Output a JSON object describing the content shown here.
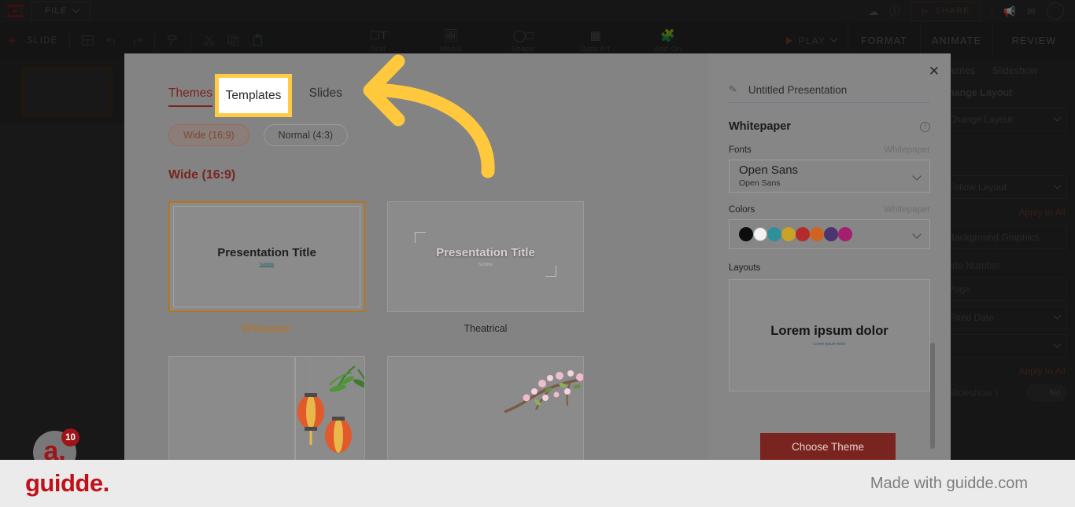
{
  "app": {
    "logo_icon": "presentation-play-icon",
    "file_menu": "FILE",
    "topbar_icons": [
      "cloud-check-icon",
      "info-icon"
    ],
    "share_label": "SHARE",
    "share_icon": "share-nodes-icon",
    "megaphone_icon": "megaphone-icon",
    "mail_icon": "mail-edit-icon",
    "avatar": "user-avatar"
  },
  "toolbar": {
    "add_slide": "SLIDE",
    "layout_icon": "layout-grid-icon",
    "undo_icon": "undo-icon",
    "redo_icon": "redo-icon",
    "paint_icon": "paint-roller-icon",
    "cut_icon": "scissors-icon",
    "copy_icon": "copy-icon",
    "paste_icon": "paste-icon",
    "insert_tools": [
      {
        "label": "Text",
        "icon": "text-box-icon"
      },
      {
        "label": "Media",
        "icon": "image-icon"
      },
      {
        "label": "Shape",
        "icon": "shapes-icon"
      },
      {
        "label": "Data Art",
        "icon": "chart-grid-icon"
      },
      {
        "label": "Add-On",
        "icon": "puzzle-piece-icon"
      }
    ],
    "play_label": "PLAY",
    "ribbon_tabs": [
      "FORMAT",
      "ANIMATE",
      "REVIEW"
    ]
  },
  "bg_right_panel": {
    "tabs": [
      "Themes",
      "Slideshow"
    ],
    "change_layout_heading": "Change Layout",
    "change_layout_select": "Change Layout",
    "follow_layout_select": "Follow Layout",
    "apply_to_all": "Apply to All",
    "background_graphics": "Background Graphics",
    "slide_number_label": "Slide Number",
    "page_field": "Page",
    "fixed_date_select": "Fixed Date",
    "empty_select": "",
    "apply_to_all_2": "Apply to All",
    "slideshow_label": "( Slideshow )",
    "toggle_value": "No"
  },
  "modal": {
    "close_icon": "close-x-icon",
    "tabs": [
      {
        "label": "Themes",
        "active": true
      },
      {
        "label": "Templates",
        "active": false,
        "highlighted": true
      },
      {
        "label": "Slides",
        "active": false
      }
    ],
    "ratio_chips": [
      {
        "label": "Wide (16:9)",
        "selected": true
      },
      {
        "label": "Normal (4:3)",
        "selected": false
      }
    ],
    "section_title": "Wide (16:9)",
    "cards": [
      {
        "name": "Whitepaper",
        "selected": true,
        "style": "whitepaper",
        "preview_title": "Presentation Title",
        "preview_subtitle": "Subtitle"
      },
      {
        "name": "Theatrical",
        "selected": false,
        "style": "theatrical",
        "preview_title": "Presentation Title",
        "preview_subtitle": "Subtitle"
      },
      {
        "name": "",
        "selected": false,
        "style": "lantern",
        "preview_title": "",
        "preview_subtitle": ""
      },
      {
        "name": "",
        "selected": false,
        "style": "blossom",
        "preview_title": "",
        "preview_subtitle": ""
      }
    ]
  },
  "sidebar": {
    "edit_icon": "pencil-icon",
    "presentation_name": "Untitled Presentation",
    "theme_name": "Whitepaper",
    "info_icon": "info-circle-icon",
    "fonts_label": "Fonts",
    "fonts_source": "Whitepaper",
    "font_primary": "Open Sans",
    "font_secondary": "Open Sans",
    "colors_label": "Colors",
    "colors_source": "Whitepaper",
    "palette": [
      "#0d0d0d",
      "#f2f2f2",
      "#2e9099",
      "#c9a227",
      "#b52a2a",
      "#cf6420",
      "#4c3470",
      "#a41f6e"
    ],
    "layouts_label": "Layouts",
    "layout_preview_title": "Lorem ipsum dolor",
    "layout_preview_subtitle": "Lorem ipsum dolor",
    "choose_theme_button": "Choose Theme"
  },
  "annotation": {
    "arrow": "curved-left-arrow",
    "arrow_color": "#FFC83D",
    "highlight_color": "#FFCB45"
  },
  "banner": {
    "logo_text": "guidde.",
    "made_with": "Made with guidde.com",
    "badge_letter": "a.",
    "badge_count": "10"
  }
}
